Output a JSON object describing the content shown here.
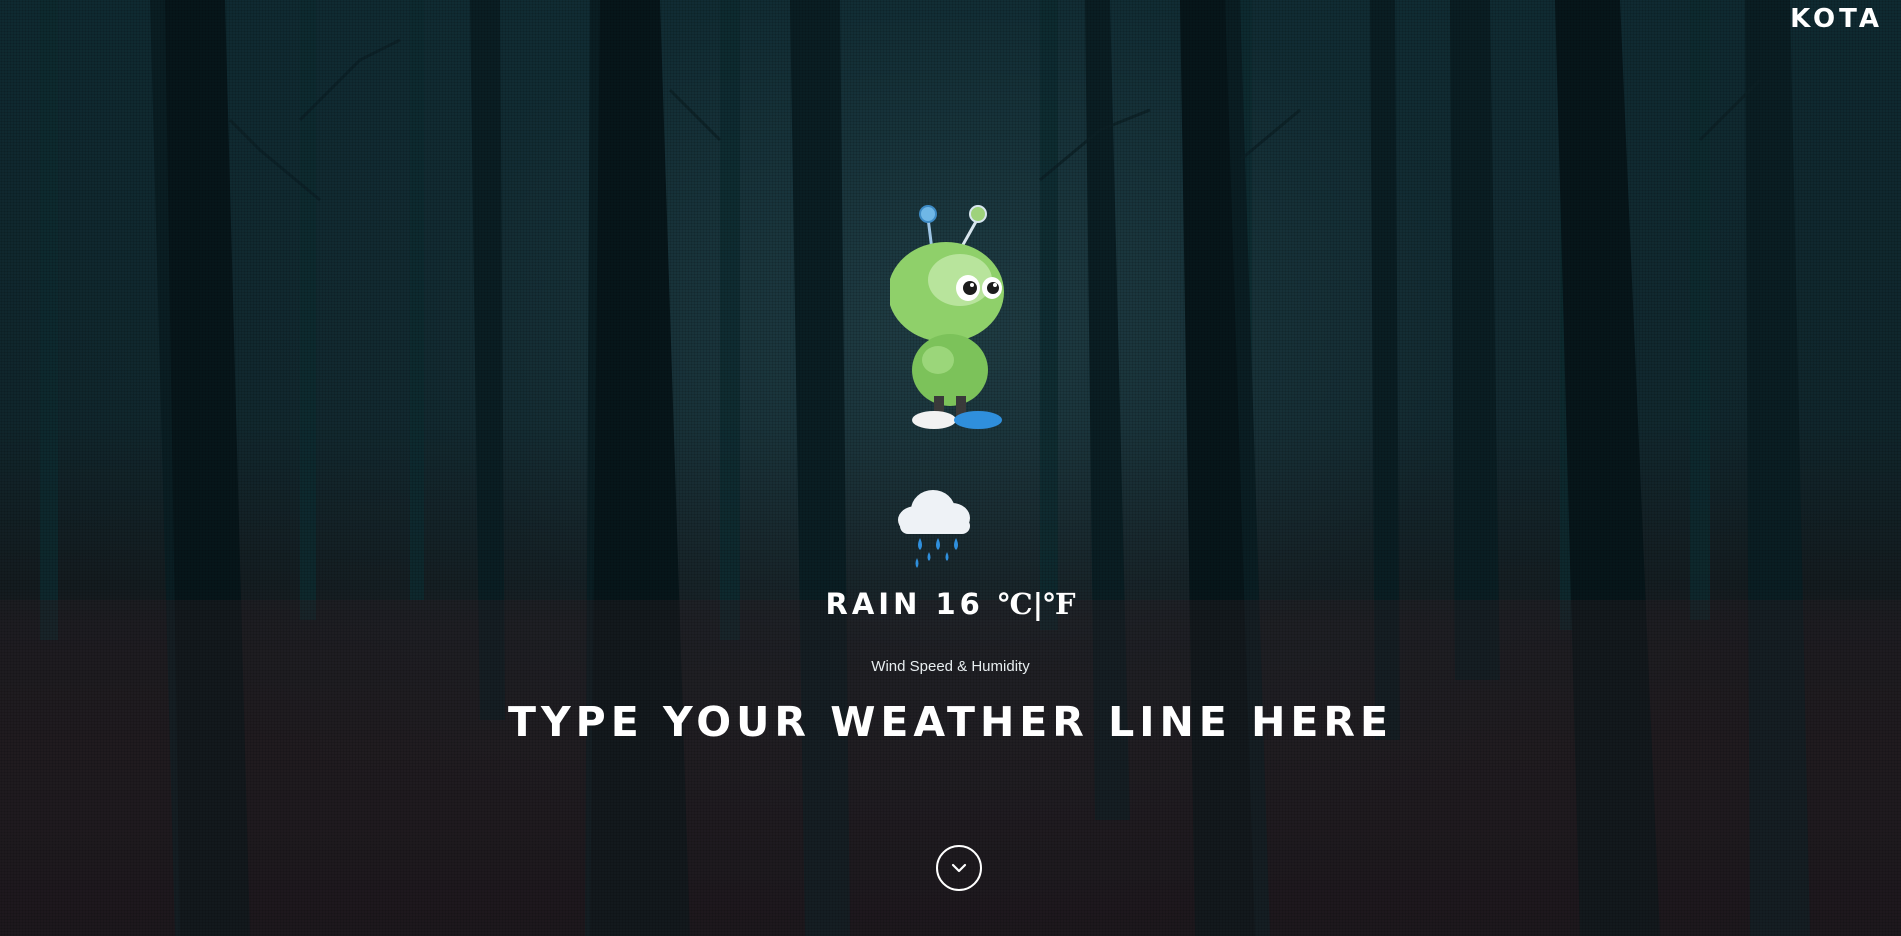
{
  "header": {
    "brand": "KOTA"
  },
  "weather": {
    "condition": "RAIN",
    "temperature": "16",
    "units": "℃|℉",
    "details": "Wind Speed & Humidity",
    "headline": "TYPE YOUR WEATHER LINE HERE",
    "icon": "rain-cloud-icon"
  },
  "mascot": {
    "icon": "green-alien-mascot"
  },
  "scroll": {
    "icon": "chevron-down-icon"
  },
  "colors": {
    "text": "#ffffff",
    "mascot_green": "#8fd06a",
    "rain_blue": "#2f8fdc"
  }
}
